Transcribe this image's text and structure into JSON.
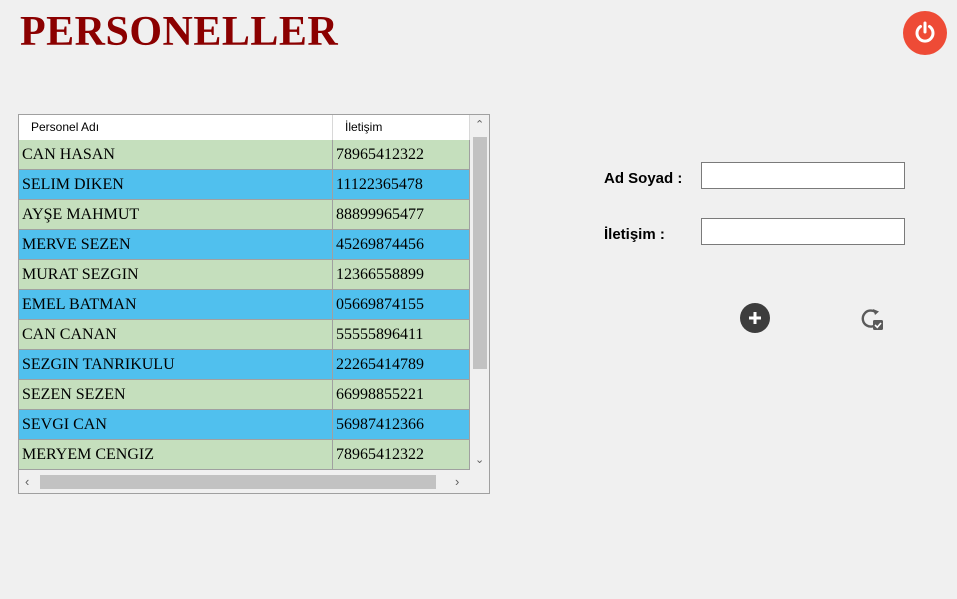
{
  "header": {
    "title": "PERSONELLER"
  },
  "grid": {
    "columns": [
      "Personel Adı",
      "İletişim"
    ],
    "rows": [
      {
        "name": "CAN HASAN",
        "contact": "78965412322"
      },
      {
        "name": "SELIM DIKEN",
        "contact": "11122365478"
      },
      {
        "name": "AYŞE MAHMUT",
        "contact": "88899965477"
      },
      {
        "name": "MERVE SEZEN",
        "contact": "45269874456"
      },
      {
        "name": "MURAT SEZGIN",
        "contact": "12366558899"
      },
      {
        "name": "EMEL BATMAN",
        "contact": "05669874155"
      },
      {
        "name": "CAN CANAN",
        "contact": "55555896411"
      },
      {
        "name": "SEZGIN TANRIKULU",
        "contact": "22265414789"
      },
      {
        "name": "SEZEN SEZEN",
        "contact": "66998855221"
      },
      {
        "name": "SEVGI CAN",
        "contact": "56987412366"
      },
      {
        "name": "MERYEM CENGIZ",
        "contact": "78965412322"
      }
    ],
    "row_colors": [
      "#c5dfbd",
      "#50c0ee"
    ]
  },
  "form": {
    "name_label": "Ad Soyad :",
    "name_value": "",
    "contact_label": "İletişim :",
    "contact_value": ""
  },
  "icons": {
    "power": "power-icon",
    "add": "plus-circle-icon",
    "refresh": "refresh-check-icon"
  },
  "colors": {
    "title": "#8b0000",
    "power_button": "#ee4b36",
    "row_green": "#c5dfbd",
    "row_blue": "#50c0ee"
  }
}
